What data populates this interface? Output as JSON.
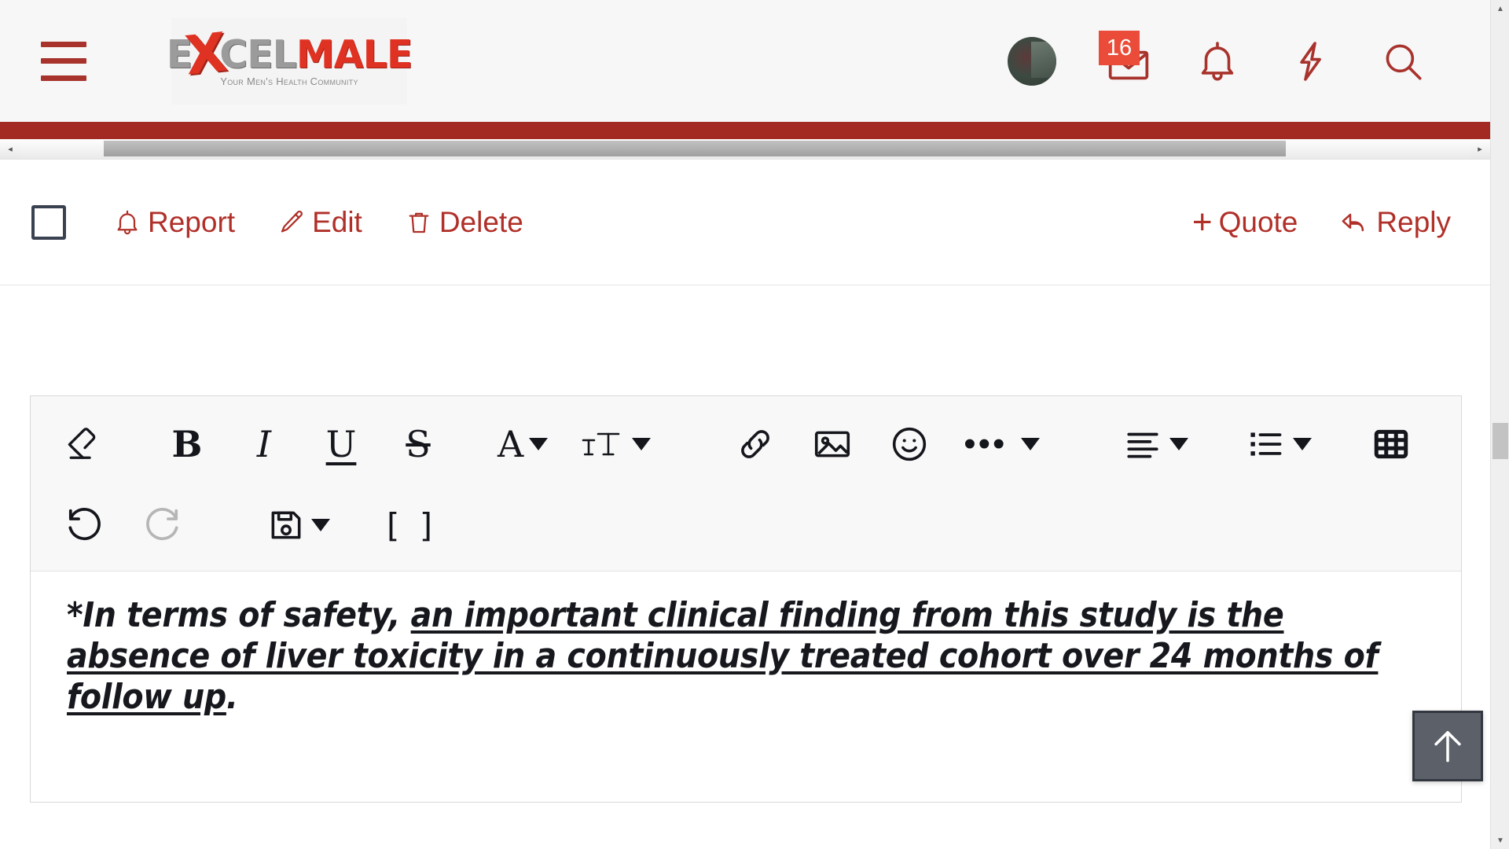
{
  "header": {
    "menu_icon": "hamburger-icon",
    "logo": {
      "text_part1": "E",
      "text_x": "X",
      "text_part2": "CEL",
      "text_part3": "MALE",
      "tagline": "Your Men's Health Community"
    },
    "avatar_label": "user-avatar",
    "mail": {
      "icon": "envelope-icon",
      "badge_count": "16"
    },
    "alerts": {
      "icon": "bell-icon"
    },
    "bolt": {
      "icon": "lightning-bolt-icon"
    },
    "search": {
      "icon": "search-icon"
    }
  },
  "scrollbars": {
    "horizontal": {
      "left_arrow": "◂",
      "right_arrow": "▸"
    },
    "vertical": {
      "up_arrow": "▲",
      "down_arrow": "▼"
    }
  },
  "post_actions": {
    "checkbox_label": "select-post",
    "left": [
      {
        "name": "report",
        "icon": "bell-icon",
        "label": "Report"
      },
      {
        "name": "edit",
        "icon": "pencil-icon",
        "label": "Edit"
      },
      {
        "name": "delete",
        "icon": "trash-icon",
        "label": "Delete"
      }
    ],
    "right": [
      {
        "name": "quote",
        "icon": "plus-icon",
        "plus": "+",
        "label": "Quote"
      },
      {
        "name": "reply",
        "icon": "reply-arrow-icon",
        "label": "Reply"
      }
    ]
  },
  "editor": {
    "toolbar_row1": [
      {
        "name": "remove-formatting",
        "icon": "eraser-icon"
      },
      {
        "name": "bold",
        "icon": "bold-icon",
        "glyph": "B"
      },
      {
        "name": "italic",
        "icon": "italic-icon",
        "glyph": "I"
      },
      {
        "name": "underline",
        "icon": "underline-icon",
        "glyph": "U"
      },
      {
        "name": "strikethrough",
        "icon": "strikethrough-icon",
        "glyph": "S"
      },
      {
        "name": "text-color",
        "icon": "text-color-icon",
        "glyph": "A",
        "has_caret": true
      },
      {
        "name": "font-size",
        "icon": "font-size-icon",
        "has_caret": true
      },
      {
        "name": "insert-link",
        "icon": "link-icon"
      },
      {
        "name": "insert-image",
        "icon": "image-icon"
      },
      {
        "name": "insert-emoji",
        "icon": "smiley-icon"
      },
      {
        "name": "more-options",
        "icon": "ellipsis-icon",
        "glyph": "•••",
        "has_caret": true
      },
      {
        "name": "text-align",
        "icon": "align-left-icon",
        "has_caret": true
      },
      {
        "name": "list",
        "icon": "bullet-list-icon",
        "has_caret": true
      },
      {
        "name": "insert-table",
        "icon": "table-icon"
      }
    ],
    "toolbar_row2": [
      {
        "name": "undo",
        "icon": "undo-icon",
        "disabled": false
      },
      {
        "name": "redo",
        "icon": "redo-icon",
        "disabled": true
      },
      {
        "name": "drafts",
        "icon": "floppy-disk-icon",
        "has_caret": true
      },
      {
        "name": "toggle-bbcode",
        "icon": "brackets-icon",
        "glyph": "[  ]"
      }
    ],
    "content": {
      "lead": "*In terms of safety, ",
      "underlined": "an important clinical finding from this study is the absence of liver toxicity in a continuously treated cohort over 24 months of follow up",
      "trailing": "."
    }
  },
  "scroll_top_button": {
    "name": "scroll-to-top",
    "icon": "arrow-up-icon"
  },
  "colors": {
    "brand_red": "#a32a23",
    "link_red": "#b03029",
    "logo_red": "#e03223",
    "badge_red": "#ea4c39",
    "header_bg": "#f7f7f7",
    "toolbar_bg": "#f8f8f8"
  }
}
